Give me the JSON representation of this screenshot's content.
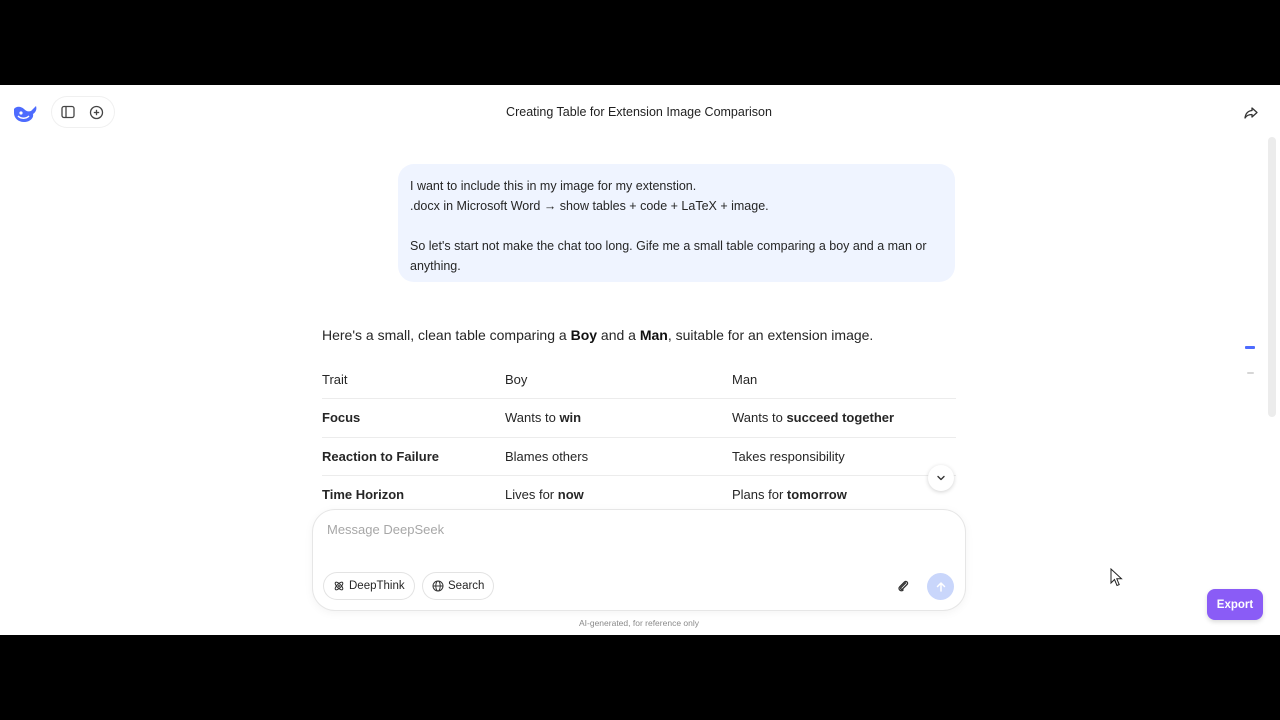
{
  "header": {
    "title": "Creating Table for Extension Image Comparison"
  },
  "icons": {
    "logo": "deepseek-whale-icon",
    "sidebar_toggle": "sidebar-toggle-icon",
    "new_chat": "new-chat-icon",
    "share": "share-icon",
    "scroll_down": "chevron-down-icon",
    "deepthink": "atom-icon",
    "search": "globe-icon",
    "attach": "paperclip-icon",
    "send": "arrow-up-icon"
  },
  "user_message": {
    "text": "I want to include this in my image for my extenstion.\n.docx in Microsoft Word → show tables + code + LaTeX + image.\n\nSo let's start not make the chat too long. Gife me a small table comparing a boy and a man or anything."
  },
  "assistant": {
    "intro_prefix": "Here's a small, clean table comparing a ",
    "intro_boy": "Boy",
    "intro_and": " and a ",
    "intro_man": "Man",
    "intro_suffix": ", suitable for an extension image.",
    "table": {
      "headers": [
        "Trait",
        "Boy",
        "Man"
      ],
      "rows": [
        {
          "trait": "Focus",
          "boy_pre": "Wants to ",
          "boy_bold": "win",
          "man_pre": "Wants to ",
          "man_bold": "succeed together"
        },
        {
          "trait": "Reaction to Failure",
          "boy_pre": "Blames others",
          "boy_bold": "",
          "man_pre": "Takes responsibility",
          "man_bold": ""
        },
        {
          "trait": "Time Horizon",
          "boy_pre": "Lives for ",
          "boy_bold": "now",
          "man_pre": "Plans for ",
          "man_bold": "tomorrow"
        }
      ]
    }
  },
  "composer": {
    "placeholder": "Message DeepSeek",
    "deepthink_label": "DeepThink",
    "search_label": "Search"
  },
  "disclaimer": "AI-generated, for reference only",
  "export_label": "Export",
  "colors": {
    "accent": "#4d6bfe",
    "bubble": "#eff4ff",
    "export": "#8a5cf6",
    "send_disabled": "#c9d6fb"
  }
}
